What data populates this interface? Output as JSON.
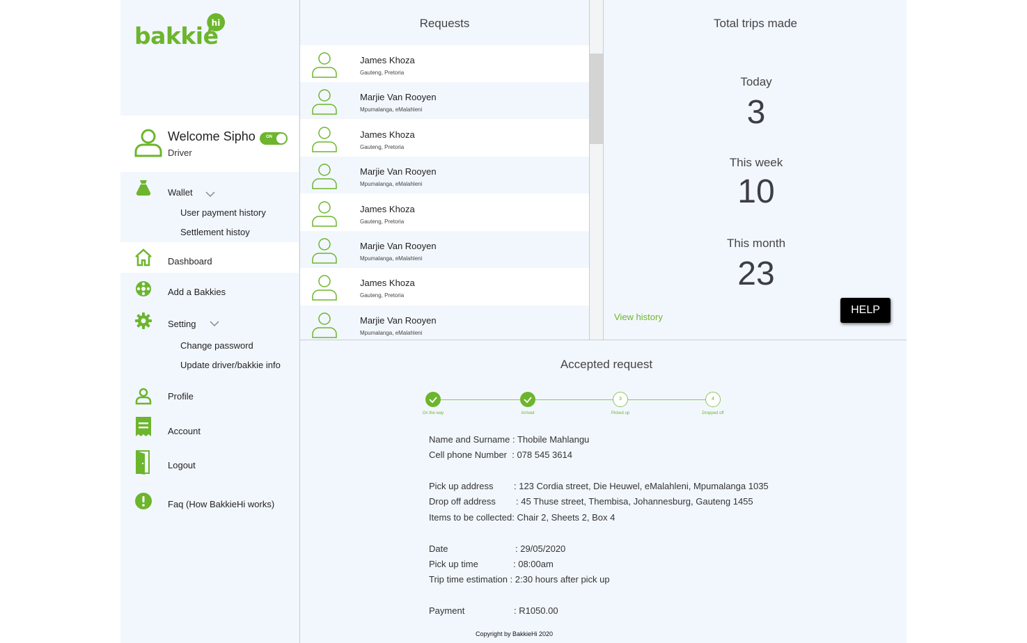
{
  "app": {
    "brand": "bakkie",
    "brand_badge": "hi"
  },
  "user": {
    "welcome": "Welcome Sipho",
    "role": "Driver",
    "toggle_label": "ON"
  },
  "sidebar": {
    "wallet": {
      "label": "Wallet",
      "subitems": [
        "User payment history",
        "Settlement histoy"
      ]
    },
    "dashboard": "Dashboard",
    "add_bakkies": "Add a Bakkies",
    "setting": {
      "label": "Setting",
      "subitems": [
        "Change password",
        "Update driver/bakkie info"
      ]
    },
    "profile": "Profile",
    "account": "Account",
    "logout": "Logout",
    "faq": "Faq (How BakkieHi works)"
  },
  "requests": {
    "title": "Requests",
    "items": [
      {
        "name": "James Khoza",
        "location": "Gauteng, Pretoria"
      },
      {
        "name": "Marjie Van Rooyen",
        "location": "Mpumalanga, eMalahleni"
      },
      {
        "name": "James Khoza",
        "location": "Gauteng, Pretoria"
      },
      {
        "name": "Marjie Van Rooyen",
        "location": "Mpumalanga, eMalahleni"
      },
      {
        "name": "James Khoza",
        "location": "Gauteng, Pretoria"
      },
      {
        "name": "Marjie Van Rooyen",
        "location": "Mpumalanga, eMalahleni"
      },
      {
        "name": "James Khoza",
        "location": "Gauteng, Pretoria"
      },
      {
        "name": "Marjie Van Rooyen",
        "location": "Mpumalanga, eMalahleni"
      }
    ]
  },
  "stats": {
    "title": "Total trips made",
    "today_label": "Today",
    "today_value": "3",
    "week_label": "This week",
    "week_value": "10",
    "month_label": "This month",
    "month_value": "23",
    "view_history": "View history",
    "help": "HELP"
  },
  "accepted": {
    "title": "Accepted request",
    "steps": [
      {
        "label": "On the way",
        "num": "1",
        "done": true
      },
      {
        "label": "Arrived",
        "num": "2",
        "done": true
      },
      {
        "label": "Picked up",
        "num": "3",
        "done": false
      },
      {
        "label": "Dropped off",
        "num": "4",
        "done": false
      }
    ],
    "name_line": "Name and Surname : Thobile Mahlangu",
    "cell_line": "Cell phone Number  : 078 545 3614",
    "pickup_key": "Pick up address",
    "pickup_val": ": 123 Cordia street, Die Heuwel, eMalahleni, Mpumalanga 1035",
    "dropoff_key": "Drop off address",
    "dropoff_val": ": 45 Thuse street, Thembisa, Johannesburg, Gauteng 1455",
    "items_line": "Items to be collected: Chair 2, Sheets 2, Box 4",
    "date_key": "Date",
    "date_val": ": 29/05/2020",
    "pickup_time_key": "Pick up time",
    "pickup_time_val": ": 08:00am",
    "trip_line": "Trip time estimation : 2:30 hours after pick up",
    "payment_key": "Payment",
    "payment_val": ": R1050.00"
  },
  "footer": {
    "copyright": "Copyright by BakkieHi 2020"
  },
  "colors": {
    "accent": "#6cb52d",
    "panel": "#f2f7fd",
    "help_bg": "#000000"
  }
}
